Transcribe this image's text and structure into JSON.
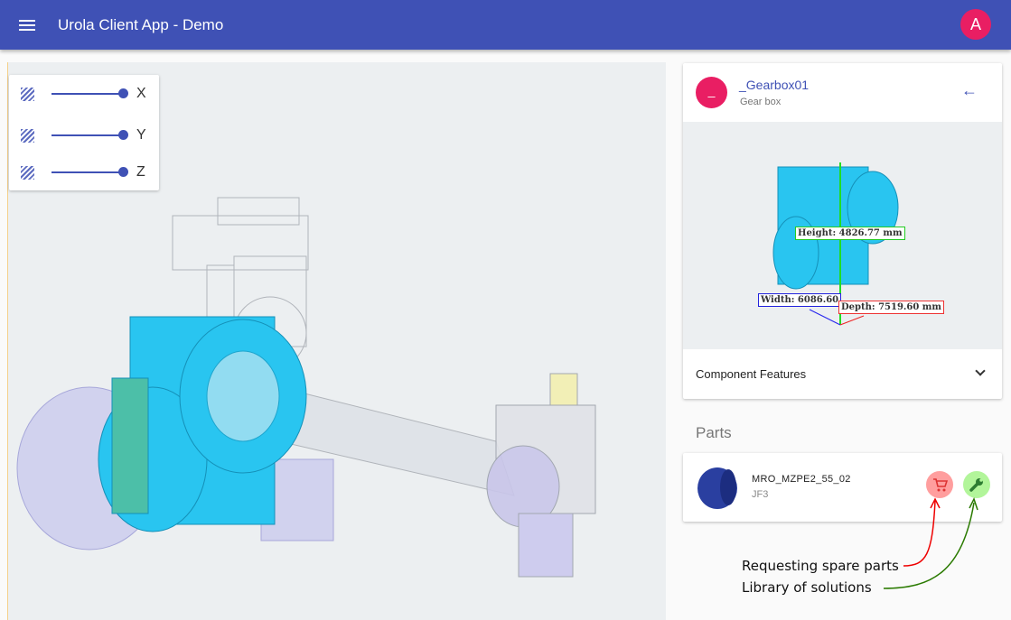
{
  "app": {
    "title": "Urola Client App - Demo",
    "user_initial": "A"
  },
  "clipping": {
    "axes": [
      "X",
      "Y",
      "Z"
    ],
    "levels": [
      1,
      1,
      1
    ]
  },
  "component": {
    "avatar": "_",
    "name": "_Gearbox01",
    "type": "Gear box",
    "features_label": "Component Features",
    "dimensions": {
      "height": "Height: 4826.77 mm",
      "width": "Width: 6086.60 mm",
      "depth": "Depth: 7519.60 mm"
    }
  },
  "parts": {
    "heading": "Parts",
    "items": [
      {
        "name": "MRO_MZPE2_55_02",
        "code": "JF3"
      }
    ]
  },
  "annotations": {
    "spare": "Requesting spare parts",
    "library": "Library of solutions"
  },
  "colors": {
    "primary": "#3f51b5",
    "accent": "#e91e63",
    "cart": "#ff9e9e",
    "wrench": "#b2f59a",
    "model": "#29c5f0"
  }
}
